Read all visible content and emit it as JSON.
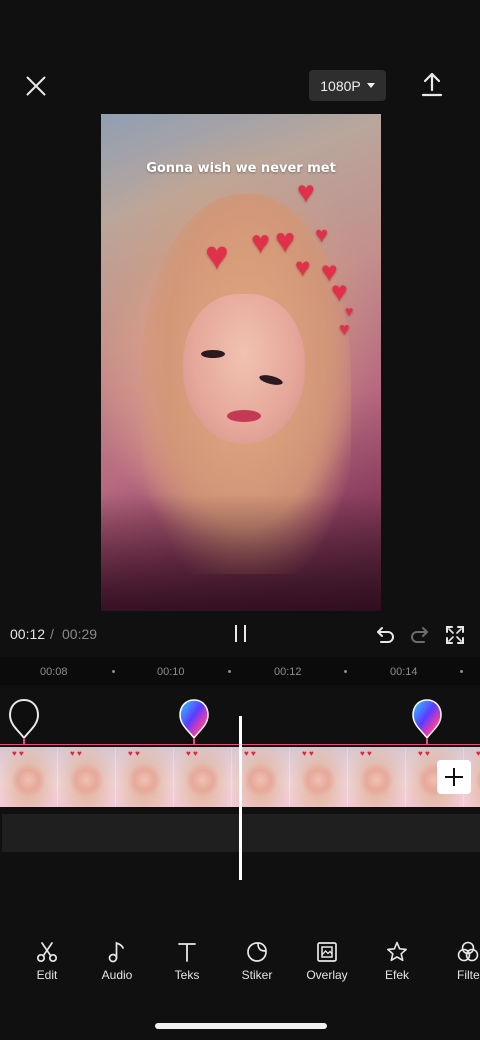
{
  "header": {
    "close_icon": "close-icon",
    "resolution_label": "1080P",
    "export_icon": "upload-icon"
  },
  "preview": {
    "caption": "Gonna wish we never met"
  },
  "playback": {
    "current_time": "00:12",
    "separator": "/",
    "total_time": "00:29"
  },
  "ruler": {
    "labels": [
      "00:08",
      "00:10",
      "00:12",
      "00:14"
    ]
  },
  "toolbar": {
    "items": [
      {
        "label": "Edit",
        "icon": "scissors-icon"
      },
      {
        "label": "Audio",
        "icon": "music-note-icon"
      },
      {
        "label": "Teks",
        "icon": "text-icon"
      },
      {
        "label": "Stiker",
        "icon": "sticker-icon"
      },
      {
        "label": "Overlay",
        "icon": "overlay-icon"
      },
      {
        "label": "Efek",
        "icon": "star-effect-icon"
      },
      {
        "label": "Filte",
        "icon": "filter-icon"
      }
    ]
  },
  "colors": {
    "background": "#101010",
    "beat_line": "#e84d7a",
    "heart": "#e0304a"
  }
}
